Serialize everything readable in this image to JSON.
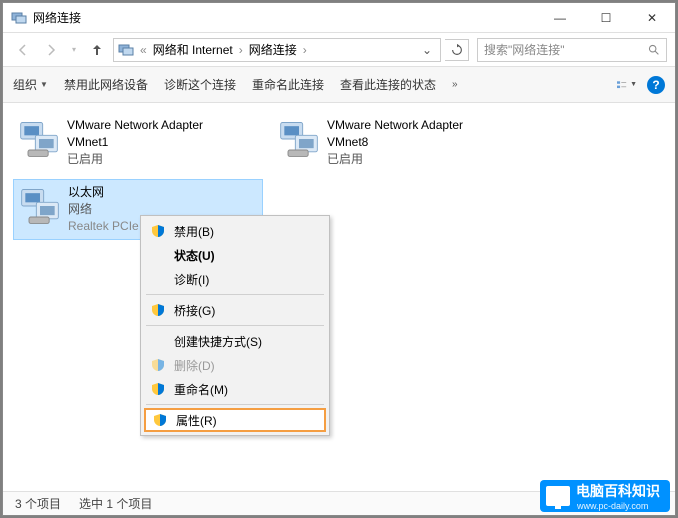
{
  "window": {
    "title": "网络连接"
  },
  "titlebar_controls": {
    "min": "—",
    "max": "☐",
    "close": "✕"
  },
  "nav": {
    "breadcrumb": [
      "网络和 Internet",
      "网络连接"
    ],
    "search_placeholder": "搜索\"网络连接\""
  },
  "toolbar": {
    "organize": "组织",
    "disable": "禁用此网络设备",
    "diagnose": "诊断这个连接",
    "rename": "重命名此连接",
    "status": "查看此连接的状态"
  },
  "adapters": [
    {
      "name": "VMware Network Adapter",
      "sub": "VMnet1",
      "status": "已启用"
    },
    {
      "name": "VMware Network Adapter",
      "sub": "VMnet8",
      "status": "已启用"
    },
    {
      "name": "以太网",
      "net": "网络",
      "desc": "Realtek PCIe GBE Family Contr..."
    }
  ],
  "context_menu": {
    "disable": "禁用(B)",
    "status": "状态(U)",
    "diagnose": "诊断(I)",
    "bridge": "桥接(G)",
    "shortcut": "创建快捷方式(S)",
    "delete": "删除(D)",
    "rename": "重命名(M)",
    "properties": "属性(R)"
  },
  "statusbar": {
    "count": "3 个项目",
    "selected": "选中 1 个项目"
  },
  "watermark": {
    "text": "电脑百科知识",
    "url": "www.pc-daily.com"
  }
}
